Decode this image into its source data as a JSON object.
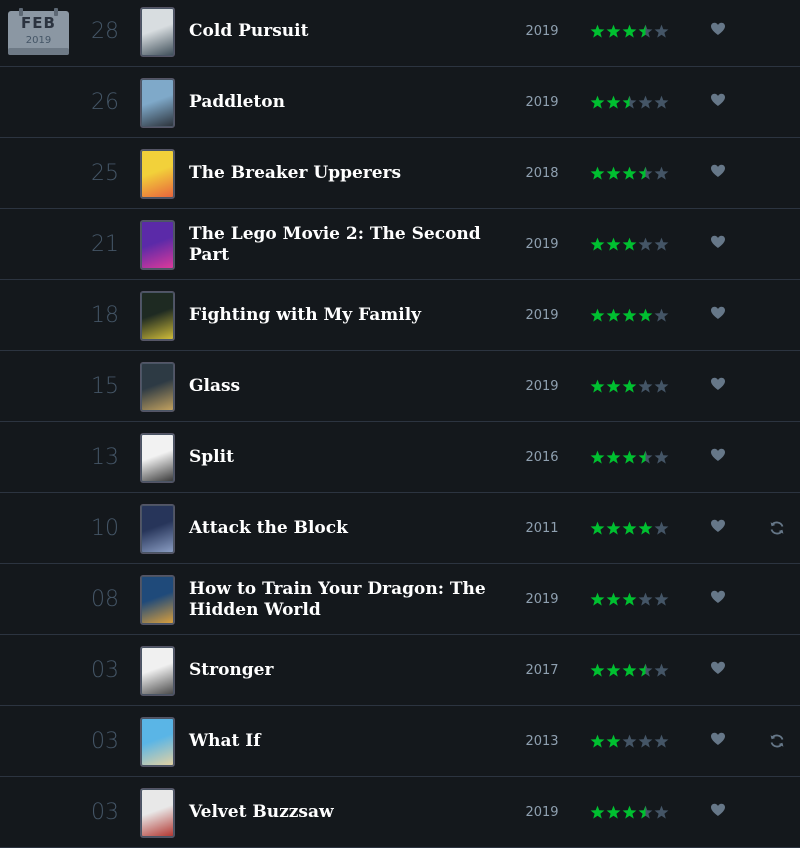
{
  "calendar": {
    "month": "FEB",
    "year": "2019"
  },
  "colors": {
    "background": "#14181c",
    "star_on": "#00c030",
    "star_off": "#456",
    "like": "#678",
    "divider": "#2c3440"
  },
  "icons": {
    "like": "heart-icon",
    "rewatch": "rewatch-icon",
    "star": "star-icon"
  },
  "entries": [
    {
      "day": "28",
      "title": "Cold Pursuit",
      "year": "2019",
      "rating": 3.5,
      "rewatch": false,
      "poster_colors": [
        "#d8dde0",
        "#3a4a55"
      ]
    },
    {
      "day": "26",
      "title": "Paddleton",
      "year": "2019",
      "rating": 2.5,
      "rewatch": false,
      "poster_colors": [
        "#7fa9c9",
        "#2a2f36"
      ]
    },
    {
      "day": "25",
      "title": "The Breaker Upperers",
      "year": "2018",
      "rating": 3.5,
      "rewatch": false,
      "poster_colors": [
        "#f2d13a",
        "#e8603c"
      ]
    },
    {
      "day": "21",
      "title": "The Lego Movie 2: The Second Part",
      "year": "2019",
      "rating": 3,
      "rewatch": false,
      "poster_colors": [
        "#5b2aa8",
        "#e23a9b"
      ]
    },
    {
      "day": "18",
      "title": "Fighting with My Family",
      "year": "2019",
      "rating": 4,
      "rewatch": false,
      "poster_colors": [
        "#1e2a22",
        "#d7c23a"
      ]
    },
    {
      "day": "15",
      "title": "Glass",
      "year": "2019",
      "rating": 3,
      "rewatch": false,
      "poster_colors": [
        "#2d3a44",
        "#c9a660"
      ]
    },
    {
      "day": "13",
      "title": "Split",
      "year": "2016",
      "rating": 3.5,
      "rewatch": false,
      "poster_colors": [
        "#f2f2f2",
        "#333333"
      ]
    },
    {
      "day": "10",
      "title": "Attack the Block",
      "year": "2011",
      "rating": 4,
      "rewatch": true,
      "poster_colors": [
        "#27355a",
        "#8ea1c7"
      ]
    },
    {
      "day": "08",
      "title": "How to Train Your Dragon: The Hidden World",
      "year": "2019",
      "rating": 3,
      "rewatch": false,
      "poster_colors": [
        "#1f4a7a",
        "#e0a23a"
      ]
    },
    {
      "day": "03",
      "title": "Stronger",
      "year": "2017",
      "rating": 3.5,
      "rewatch": false,
      "poster_colors": [
        "#f0f0f0",
        "#444444"
      ]
    },
    {
      "day": "03",
      "title": "What If",
      "year": "2013",
      "rating": 2,
      "rewatch": true,
      "poster_colors": [
        "#5ab5e6",
        "#e8d2a0"
      ]
    },
    {
      "day": "03",
      "title": "Velvet Buzzsaw",
      "year": "2019",
      "rating": 3.5,
      "rewatch": false,
      "poster_colors": [
        "#e8e8e8",
        "#b0302a"
      ]
    }
  ]
}
